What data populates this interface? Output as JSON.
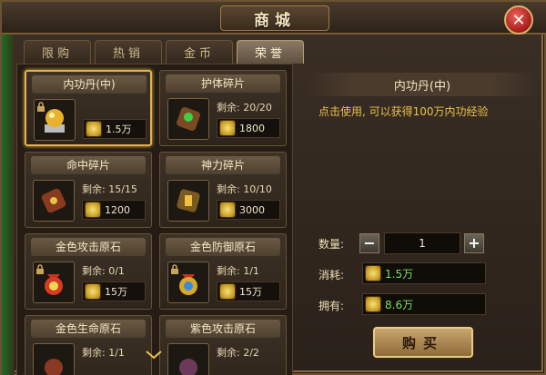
{
  "window": {
    "title": "商城",
    "close": "✕"
  },
  "tabs": [
    {
      "label": "限购",
      "active": false
    },
    {
      "label": "热销",
      "active": false
    },
    {
      "label": "金币",
      "active": false
    },
    {
      "label": "荣誉",
      "active": true
    }
  ],
  "items": [
    {
      "name": "内功丹(中)",
      "remain": "",
      "price": "1.5万",
      "icon": "golden-orb-icon",
      "selected": true
    },
    {
      "name": "护体碎片",
      "remain": "剩余: 20/20",
      "price": "1800",
      "icon": "armor-shard-icon",
      "selected": false
    },
    {
      "name": "命中碎片",
      "remain": "剩余: 15/15",
      "price": "1200",
      "icon": "accuracy-shard-icon",
      "selected": false
    },
    {
      "name": "神力碎片",
      "remain": "剩余: 10/10",
      "price": "3000",
      "icon": "power-shard-icon",
      "selected": false
    },
    {
      "name": "金色攻击原石",
      "remain": "剩余: 0/1",
      "price": "15万",
      "icon": "red-stone-pouch-icon",
      "selected": false
    },
    {
      "name": "金色防御原石",
      "remain": "剩余: 1/1",
      "price": "15万",
      "icon": "blue-stone-pouch-icon",
      "selected": false
    },
    {
      "name": "金色生命原石",
      "remain": "剩余: 1/1",
      "price": "",
      "icon": "green-stone-pouch-icon",
      "selected": false
    },
    {
      "name": "紫色攻击原石",
      "remain": "剩余: 2/2",
      "price": "",
      "icon": "purple-stone-pouch-icon",
      "selected": false
    }
  ],
  "detail": {
    "title": "内功丹(中)",
    "description": "点击使用, 可以获得100万内功经验",
    "quantity_label": "数量:",
    "quantity_value": "1",
    "minus": "−",
    "plus": "+",
    "cost_label": "消耗:",
    "cost_value": "1.5万",
    "owned_label": "拥有:",
    "owned_value": "8.6万",
    "buy_label": "购买"
  },
  "colors": {
    "accent_gold": "#e4b24a",
    "value_green": "#7ee05a",
    "desc_yellow": "#e8c24a",
    "close_red": "#a41c18"
  }
}
